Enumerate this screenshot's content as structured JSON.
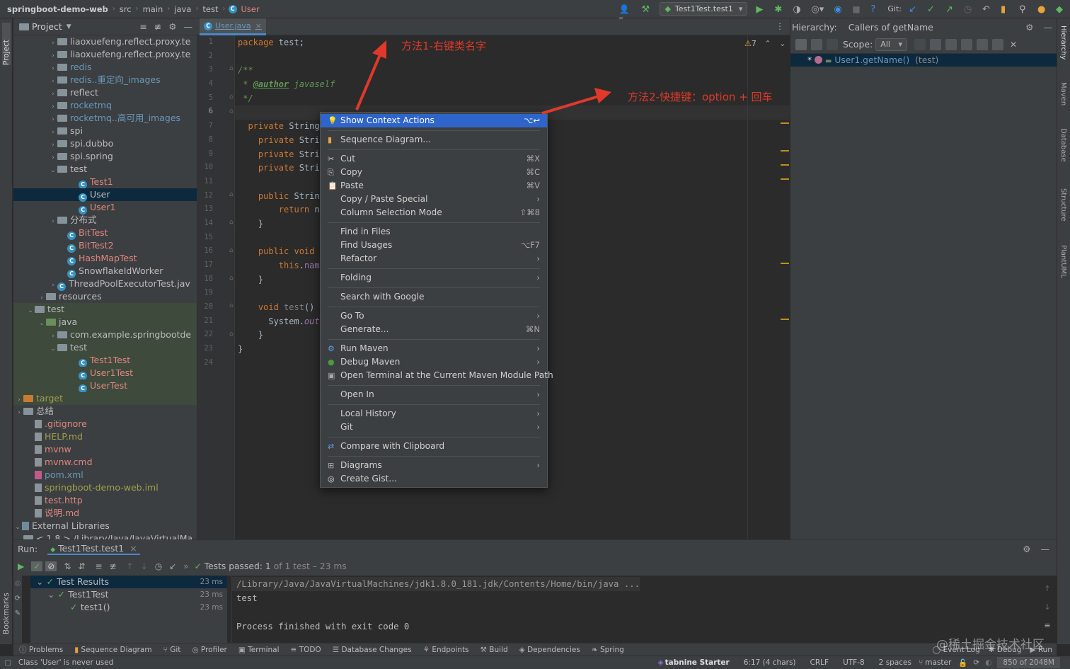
{
  "topbar": {
    "breadcrumb": [
      "springboot-demo-web",
      "src",
      "main",
      "java",
      "test",
      "User"
    ],
    "run_config": "Test1Test.test1",
    "git_label": "Git:"
  },
  "left_stripe": {
    "project": "Project",
    "bookmarks": "Bookmarks"
  },
  "right_stripe": [
    "Hierarchy",
    "Maven",
    "Database",
    "Structure",
    "PlantUML"
  ],
  "project": {
    "title": "Project",
    "rows": [
      {
        "label": "liaoxuefeng.reflect.proxy.te",
        "arrow": "›",
        "icon": "folder",
        "indent": 72,
        "color": "#bbbbbb"
      },
      {
        "label": "liaoxuefeng.reflect.proxy.te",
        "arrow": "›",
        "icon": "folder",
        "indent": 72,
        "color": "#bbbbbb"
      },
      {
        "label": "redis",
        "arrow": "›",
        "icon": "folder",
        "indent": 72,
        "color": "#6897bb"
      },
      {
        "label": "redis..重定向_images",
        "arrow": "›",
        "icon": "folder",
        "indent": 72,
        "color": "#6897bb"
      },
      {
        "label": "reflect",
        "arrow": "›",
        "icon": "folder",
        "indent": 72,
        "color": "#bbbbbb"
      },
      {
        "label": "rocketmq",
        "arrow": "›",
        "icon": "folder",
        "indent": 72,
        "color": "#6897bb"
      },
      {
        "label": "rocketmq..高可用_images",
        "arrow": "›",
        "icon": "folder",
        "indent": 72,
        "color": "#6897bb"
      },
      {
        "label": "spi",
        "arrow": "›",
        "icon": "folder",
        "indent": 72,
        "color": "#bbbbbb"
      },
      {
        "label": "spi.dubbo",
        "arrow": "›",
        "icon": "folder",
        "indent": 72,
        "color": "#bbbbbb"
      },
      {
        "label": "spi.spring",
        "arrow": "›",
        "icon": "folder",
        "indent": 72,
        "color": "#bbbbbb"
      },
      {
        "label": "test",
        "arrow": "⌄",
        "icon": "folder",
        "indent": 72,
        "color": "#bbbbbb"
      },
      {
        "label": "Test1",
        "arrow": "",
        "icon": "class",
        "indent": 102,
        "color": "#e0867f"
      },
      {
        "label": "User",
        "arrow": "",
        "icon": "class",
        "indent": 102,
        "color": "#bbbbbb",
        "selected": true
      },
      {
        "label": "User1",
        "arrow": "",
        "icon": "class",
        "indent": 102,
        "color": "#e0867f"
      },
      {
        "label": "分布式",
        "arrow": "›",
        "icon": "folder",
        "indent": 72,
        "color": "#bbbbbb"
      },
      {
        "label": "BitTest",
        "arrow": "",
        "icon": "class",
        "indent": 86,
        "color": "#e0867f"
      },
      {
        "label": "BitTest2",
        "arrow": "",
        "icon": "class",
        "indent": 86,
        "color": "#e0867f"
      },
      {
        "label": "HashMapTest",
        "arrow": "",
        "icon": "class",
        "indent": 86,
        "color": "#e0867f"
      },
      {
        "label": "SnowflakeIdWorker",
        "arrow": "",
        "icon": "class",
        "indent": 86,
        "color": "#bbbbbb"
      },
      {
        "label": "ThreadPoolExecutorTest.jav",
        "arrow": "›",
        "icon": "class",
        "indent": 72,
        "color": "#bbbbbb"
      },
      {
        "label": "resources",
        "arrow": "›",
        "icon": "folder",
        "indent": 56,
        "color": "#bbbbbb"
      },
      {
        "label": "test",
        "arrow": "⌄",
        "icon": "folder",
        "indent": 40,
        "color": "#bbbbbb",
        "green": true
      },
      {
        "label": "java",
        "arrow": "⌄",
        "icon": "folder-green",
        "indent": 56,
        "color": "#bbbbbb",
        "green": true
      },
      {
        "label": "com.example.springbootde",
        "arrow": "›",
        "icon": "folder",
        "indent": 72,
        "color": "#bbbbbb",
        "green": true
      },
      {
        "label": "test",
        "arrow": "⌄",
        "icon": "folder",
        "indent": 72,
        "color": "#bbbbbb",
        "green": true
      },
      {
        "label": "Test1Test",
        "arrow": "",
        "icon": "class",
        "indent": 102,
        "color": "#e0867f",
        "green": true
      },
      {
        "label": "User1Test",
        "arrow": "",
        "icon": "class",
        "indent": 102,
        "color": "#e0867f",
        "green": true
      },
      {
        "label": "UserTest",
        "arrow": "",
        "icon": "class",
        "indent": 102,
        "color": "#e0867f",
        "green": true
      },
      {
        "label": "target",
        "arrow": "›",
        "icon": "folder-orange",
        "indent": 24,
        "color": "#a0a04a",
        "green": true
      },
      {
        "label": "总结",
        "arrow": "›",
        "icon": "folder",
        "indent": 24,
        "color": "#bbbbbb"
      },
      {
        "label": ".gitignore",
        "arrow": "",
        "icon": "file",
        "indent": 40,
        "color": "#e0867f"
      },
      {
        "label": "HELP.md",
        "arrow": "",
        "icon": "file",
        "indent": 40,
        "color": "#a0a04a"
      },
      {
        "label": "mvnw",
        "arrow": "",
        "icon": "file",
        "indent": 40,
        "color": "#e0867f"
      },
      {
        "label": "mvnw.cmd",
        "arrow": "",
        "icon": "file",
        "indent": 40,
        "color": "#e0867f"
      },
      {
        "label": "pom.xml",
        "arrow": "",
        "icon": "maven",
        "indent": 40,
        "color": "#6897bb"
      },
      {
        "label": "springboot-demo-web.iml",
        "arrow": "",
        "icon": "file",
        "indent": 40,
        "color": "#a0a04a"
      },
      {
        "label": "test.http",
        "arrow": "",
        "icon": "file",
        "indent": 40,
        "color": "#e0867f"
      },
      {
        "label": "说明.md",
        "arrow": "",
        "icon": "file",
        "indent": 40,
        "color": "#e0867f"
      },
      {
        "label": "External Libraries",
        "arrow": "⌄",
        "icon": "libs",
        "indent": 8,
        "color": "#bbbbbb"
      },
      {
        "label": "< 1.8 >  /Library/Java/JavaVirtualMa",
        "arrow": "⌄",
        "icon": "folder",
        "indent": 24,
        "color": "#bbbbbb"
      }
    ]
  },
  "editor": {
    "tab": "User.java",
    "warnings": "7",
    "line_numbers": [
      "1",
      "2",
      "3",
      "4",
      "5",
      "6",
      "7",
      "8",
      "9",
      "10",
      "11",
      "12",
      "13",
      "14",
      "15",
      "16",
      "17",
      "18",
      "19",
      "20",
      "21",
      "22",
      "23",
      "24"
    ]
  },
  "hierarchy": {
    "title": "Hierarchy:",
    "subtitle": "Callers of getName",
    "scope_label": "Scope:",
    "scope_value": "All",
    "item": "User1.getName()",
    "item_pkg": "(test)"
  },
  "context_menu": [
    {
      "label": "Show Context Actions",
      "shortcut": "⌥↩",
      "highlight": true,
      "icon": "bulb"
    },
    {
      "sep": true
    },
    {
      "label": "Sequence Diagram...",
      "shortcut": "",
      "icon": "seq"
    },
    {
      "sep": true
    },
    {
      "label": "Cut",
      "shortcut": "⌘X",
      "icon": "cut"
    },
    {
      "label": "Copy",
      "shortcut": "⌘C",
      "icon": "copy"
    },
    {
      "label": "Paste",
      "shortcut": "⌘V",
      "icon": "paste"
    },
    {
      "label": "Copy / Paste Special",
      "shortcut": "›"
    },
    {
      "label": "Column Selection Mode",
      "shortcut": "⇧⌘8"
    },
    {
      "sep": true
    },
    {
      "label": "Find in Files",
      "shortcut": ""
    },
    {
      "label": "Find Usages",
      "shortcut": "⌥F7"
    },
    {
      "label": "Refactor",
      "shortcut": "›"
    },
    {
      "sep": true
    },
    {
      "label": "Folding",
      "shortcut": "›"
    },
    {
      "sep": true
    },
    {
      "label": "Search with Google",
      "shortcut": ""
    },
    {
      "sep": true
    },
    {
      "label": "Go To",
      "shortcut": "›"
    },
    {
      "label": "Generate...",
      "shortcut": "⌘N"
    },
    {
      "sep": true
    },
    {
      "label": "Run Maven",
      "shortcut": "›",
      "icon": "gear"
    },
    {
      "label": "Debug Maven",
      "shortcut": "›",
      "icon": "debug"
    },
    {
      "label": "Open Terminal at the Current Maven Module Path",
      "shortcut": "",
      "icon": "term"
    },
    {
      "sep": true
    },
    {
      "label": "Open In",
      "shortcut": "›"
    },
    {
      "sep": true
    },
    {
      "label": "Local History",
      "shortcut": "›"
    },
    {
      "label": "Git",
      "shortcut": "›"
    },
    {
      "sep": true
    },
    {
      "label": "Compare with Clipboard",
      "shortcut": "",
      "icon": "compare"
    },
    {
      "sep": true
    },
    {
      "label": "Diagrams",
      "shortcut": "›",
      "icon": "diagram"
    },
    {
      "label": "Create Gist...",
      "shortcut": "",
      "icon": "github"
    }
  ],
  "annotations": {
    "method1": "方法1-右键类名字",
    "method2": "方法2-快捷键：option + 回车"
  },
  "run": {
    "label": "Run:",
    "config": "Test1Test.test1",
    "status_prefix": "Tests passed:",
    "status_count": "1",
    "status_suffix": "of 1 test – 23 ms",
    "results": [
      {
        "label": "Test Results",
        "ms": "23 ms",
        "indent": 8
      },
      {
        "label": "Test1Test",
        "ms": "23 ms",
        "indent": 24
      },
      {
        "label": "test1()",
        "ms": "23 ms",
        "indent": 56
      }
    ],
    "console": [
      "/Library/Java/JavaVirtualMachines/jdk1.8.0_181.jdk/Contents/Home/bin/java ...",
      "test",
      "",
      "Process finished with exit code 0"
    ]
  },
  "bottom_tools": [
    "Problems",
    "Sequence Diagram",
    "Git",
    "Profiler",
    "Terminal",
    "TODO",
    "Database Changes",
    "Endpoints",
    "Build",
    "Dependencies",
    "Spring"
  ],
  "bottom_right_tools": [
    "Event Log",
    "Debug",
    "Run"
  ],
  "status": {
    "message": "Class 'User' is never used",
    "tabnine": "tabnine Starter",
    "position": "6:17 (4 chars)",
    "line_sep": "CRLF",
    "encoding": "UTF-8",
    "indent": "2 spaces",
    "branch": "master",
    "memory": "850 of 2048M"
  },
  "watermark": "@稀土掘金技术社区"
}
